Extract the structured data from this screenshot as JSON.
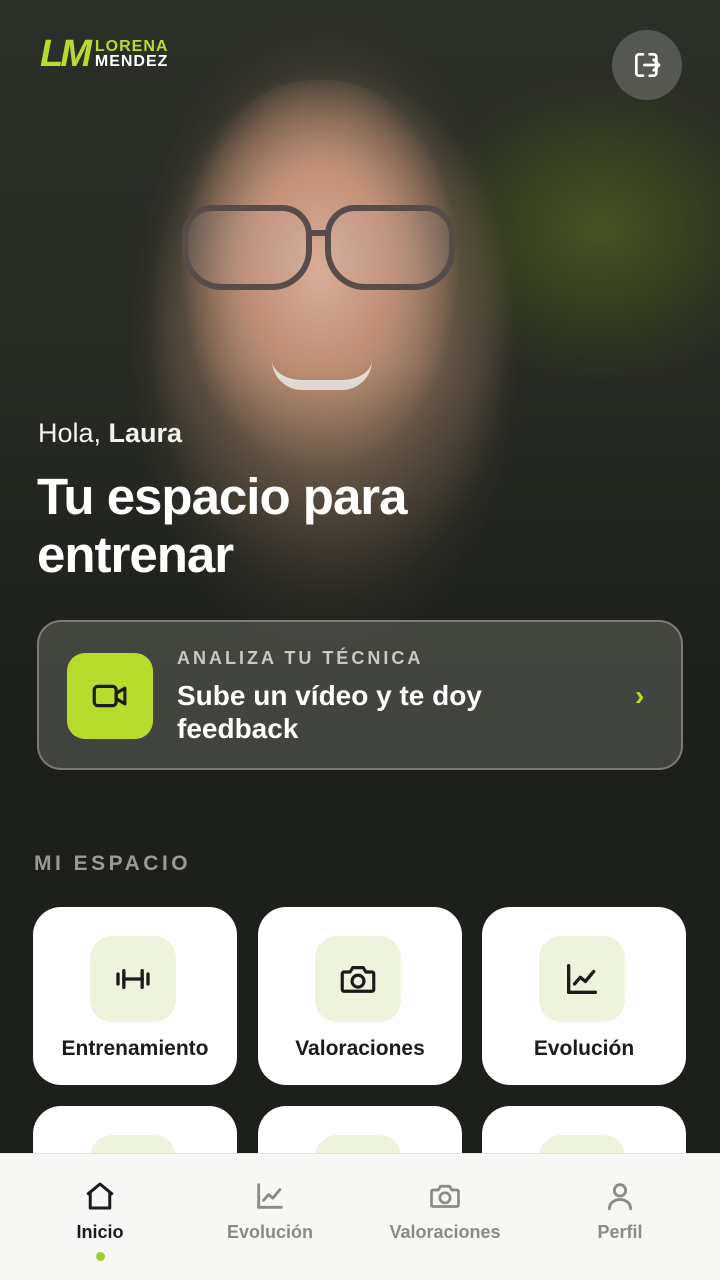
{
  "brand": {
    "mark": "LM",
    "line1": "LORENA",
    "line2": "MENDEZ",
    "accent": "#b7dc2e"
  },
  "header": {
    "logout_icon": "logout-icon"
  },
  "hero": {
    "greeting_prefix": "Hola,",
    "user_name": "Laura",
    "headline": "Tu espacio para entrenar"
  },
  "cta": {
    "kicker": "ANALIZA TU TÉCNICA",
    "title": "Sube un vídeo y te doy feedback",
    "icon": "video-camera-icon",
    "chevron": "›"
  },
  "section": {
    "title": "MI ESPACIO"
  },
  "tiles": [
    {
      "label": "Entrenamiento",
      "icon": "dumbbell-icon"
    },
    {
      "label": "Valoraciones",
      "icon": "camera-icon"
    },
    {
      "label": "Evolución",
      "icon": "chart-line-icon"
    }
  ],
  "nav": [
    {
      "label": "Inicio",
      "icon": "home-icon",
      "active": true
    },
    {
      "label": "Evolución",
      "icon": "chart-line-icon",
      "active": false
    },
    {
      "label": "Valoraciones",
      "icon": "camera-icon",
      "active": false
    },
    {
      "label": "Perfil",
      "icon": "user-icon",
      "active": false
    }
  ]
}
